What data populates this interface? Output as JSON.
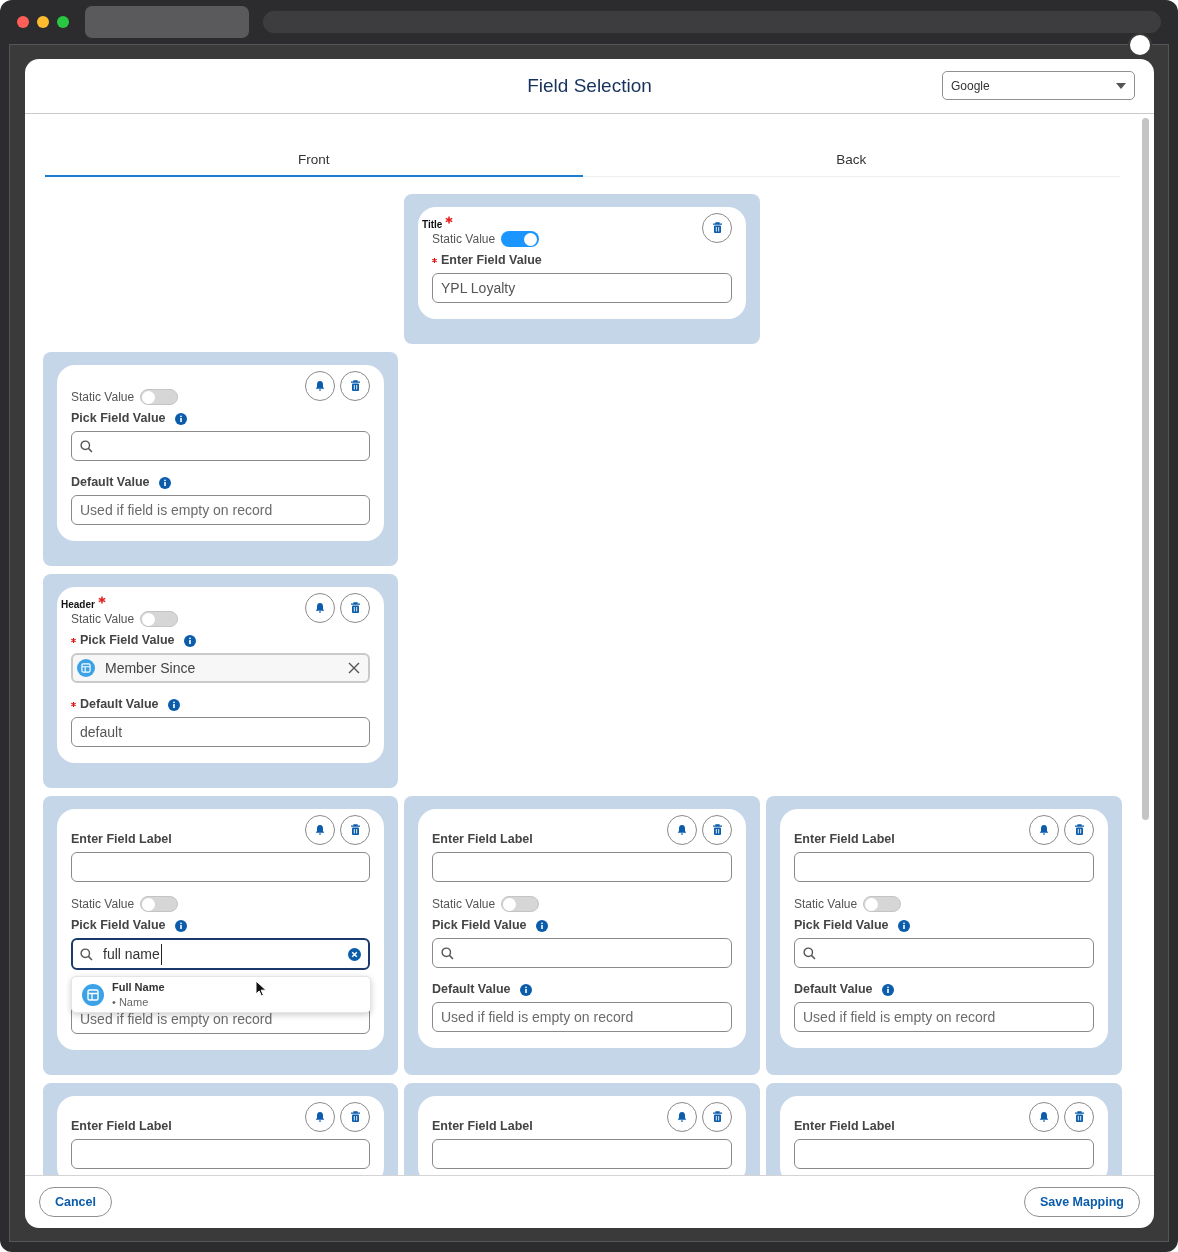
{
  "window": {
    "title": "Field Selection"
  },
  "object_select": {
    "value": "Google"
  },
  "tabs": [
    {
      "label": "Front",
      "selected": true
    },
    {
      "label": "Back",
      "selected": false
    }
  ],
  "rows": [
    {
      "slots": [
        {
          "kind": "blank"
        },
        {
          "kind": "card",
          "heading": "Title",
          "heading_required": true,
          "bell": false,
          "items": [
            {
              "kind": "toggle",
              "label": "Static Value",
              "on": true
            },
            {
              "kind": "field",
              "label": "Enter Field Value",
              "required": true,
              "info": false,
              "input": {
                "kind": "text",
                "value": "YPL Loyalty"
              }
            }
          ]
        }
      ]
    },
    {
      "slots": [
        {
          "kind": "card",
          "bell": true,
          "items": [
            {
              "kind": "toggle",
              "label": "Static Value",
              "on": false
            },
            {
              "kind": "field",
              "label": "Pick Field Value",
              "required": false,
              "info": true,
              "input": {
                "kind": "search"
              }
            },
            {
              "kind": "field",
              "label": "Default Value",
              "required": false,
              "info": true,
              "input": {
                "kind": "text",
                "placeholder": "Used if field is empty on record"
              }
            }
          ]
        }
      ]
    },
    {
      "slots": [
        {
          "kind": "card",
          "heading": "Header",
          "heading_required": true,
          "bell": true,
          "items": [
            {
              "kind": "toggle",
              "label": "Static Value",
              "on": false
            },
            {
              "kind": "field",
              "label": "Pick Field Value",
              "required": true,
              "info": true,
              "input": {
                "kind": "chip",
                "value": "Member Since"
              }
            },
            {
              "kind": "field",
              "label": "Default Value",
              "required": true,
              "info": true,
              "input": {
                "kind": "text",
                "value": "default"
              }
            }
          ]
        }
      ]
    },
    {
      "slots": [
        {
          "kind": "card",
          "bell": true,
          "items": [
            {
              "kind": "field",
              "label": "Enter Field Label",
              "required": false,
              "info": false,
              "input": {
                "kind": "text"
              }
            },
            {
              "kind": "toggle",
              "label": "Static Value",
              "on": false
            },
            {
              "kind": "field",
              "label": "Pick Field Value",
              "required": false,
              "info": true,
              "input": {
                "kind": "search",
                "value": "full name",
                "focused": true,
                "results": [
                  {
                    "title": "Full Name",
                    "subtitle": "• Name"
                  }
                ]
              }
            },
            {
              "kind": "field",
              "input": {
                "kind": "text",
                "placeholder": "Used if field is empty on record"
              }
            }
          ]
        },
        {
          "kind": "card",
          "bell": true,
          "items": [
            {
              "kind": "field",
              "label": "Enter Field Label",
              "required": false,
              "info": false,
              "input": {
                "kind": "text"
              }
            },
            {
              "kind": "toggle",
              "label": "Static Value",
              "on": false
            },
            {
              "kind": "field",
              "label": "Pick Field Value",
              "required": false,
              "info": true,
              "input": {
                "kind": "search"
              }
            },
            {
              "kind": "field",
              "label": "Default Value",
              "required": false,
              "info": true,
              "input": {
                "kind": "text",
                "placeholder": "Used if field is empty on record"
              }
            }
          ]
        },
        {
          "kind": "card",
          "bell": true,
          "items": [
            {
              "kind": "field",
              "label": "Enter Field Label",
              "required": false,
              "info": false,
              "input": {
                "kind": "text"
              }
            },
            {
              "kind": "toggle",
              "label": "Static Value",
              "on": false
            },
            {
              "kind": "field",
              "label": "Pick Field Value",
              "required": false,
              "info": true,
              "input": {
                "kind": "search"
              }
            },
            {
              "kind": "field",
              "label": "Default Value",
              "required": false,
              "info": true,
              "input": {
                "kind": "text",
                "placeholder": "Used if field is empty on record"
              }
            }
          ]
        }
      ]
    },
    {
      "slots": [
        {
          "kind": "card",
          "bell": true,
          "items": [
            {
              "kind": "field",
              "label": "Enter Field Label",
              "required": false,
              "info": false,
              "input": {
                "kind": "text"
              }
            }
          ]
        },
        {
          "kind": "card",
          "bell": true,
          "items": [
            {
              "kind": "field",
              "label": "Enter Field Label",
              "required": false,
              "info": false,
              "input": {
                "kind": "text"
              }
            }
          ]
        },
        {
          "kind": "card",
          "bell": true,
          "items": [
            {
              "kind": "field",
              "label": "Enter Field Label",
              "required": false,
              "info": false,
              "input": {
                "kind": "text"
              }
            }
          ]
        }
      ]
    }
  ],
  "footer": {
    "cancel": "Cancel",
    "save": "Save Mapping"
  }
}
